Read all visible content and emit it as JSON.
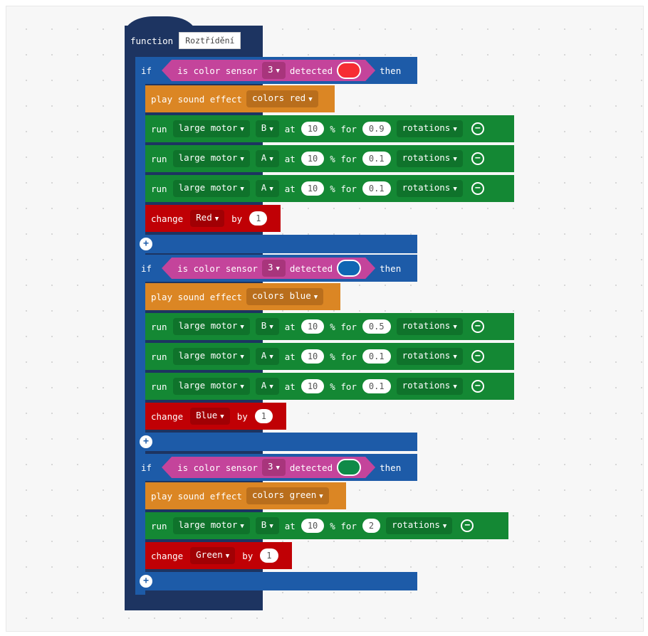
{
  "function": {
    "keyword": "function",
    "name": "Roztřídění"
  },
  "ifs": [
    {
      "if_label": "if",
      "cond_text": "is color sensor",
      "port": "3",
      "detected": "detected",
      "color": "#f62d33",
      "then": "then",
      "sound": {
        "label": "play sound effect",
        "value": "colors red"
      },
      "motors": [
        {
          "run": "run",
          "motor": "large motor",
          "port": "B",
          "at": "at",
          "speed": "10",
          "pct_for": "% for",
          "amount": "0.9",
          "unit": "rotations"
        },
        {
          "run": "run",
          "motor": "large motor",
          "port": "A",
          "at": "at",
          "speed": "10",
          "pct_for": "% for",
          "amount": "0.1",
          "unit": "rotations"
        },
        {
          "run": "run",
          "motor": "large motor",
          "port": "A",
          "at": "at",
          "speed": "10",
          "pct_for": "% for",
          "amount": "0.1",
          "unit": "rotations"
        }
      ],
      "change": {
        "label": "change",
        "var": "Red",
        "by": "by",
        "value": "1"
      }
    },
    {
      "if_label": "if",
      "cond_text": "is color sensor",
      "port": "3",
      "detected": "detected",
      "color": "#0f66b3",
      "then": "then",
      "sound": {
        "label": "play sound effect",
        "value": "colors blue"
      },
      "motors": [
        {
          "run": "run",
          "motor": "large motor",
          "port": "B",
          "at": "at",
          "speed": "10",
          "pct_for": "% for",
          "amount": "0.5",
          "unit": "rotations"
        },
        {
          "run": "run",
          "motor": "large motor",
          "port": "A",
          "at": "at",
          "speed": "10",
          "pct_for": "% for",
          "amount": "0.1",
          "unit": "rotations"
        },
        {
          "run": "run",
          "motor": "large motor",
          "port": "A",
          "at": "at",
          "speed": "10",
          "pct_for": "% for",
          "amount": "0.1",
          "unit": "rotations"
        }
      ],
      "change": {
        "label": "change",
        "var": "Blue",
        "by": "by",
        "value": "1"
      }
    },
    {
      "if_label": "if",
      "cond_text": "is color sensor",
      "port": "3",
      "detected": "detected",
      "color": "#0f8a48",
      "then": "then",
      "sound": {
        "label": "play sound effect",
        "value": "colors green"
      },
      "motors": [
        {
          "run": "run",
          "motor": "large motor",
          "port": "B",
          "at": "at",
          "speed": "10",
          "pct_for": "% for",
          "amount": "2",
          "unit": "rotations"
        }
      ],
      "change": {
        "label": "change",
        "var": "Green",
        "by": "by",
        "value": "1"
      }
    }
  ]
}
